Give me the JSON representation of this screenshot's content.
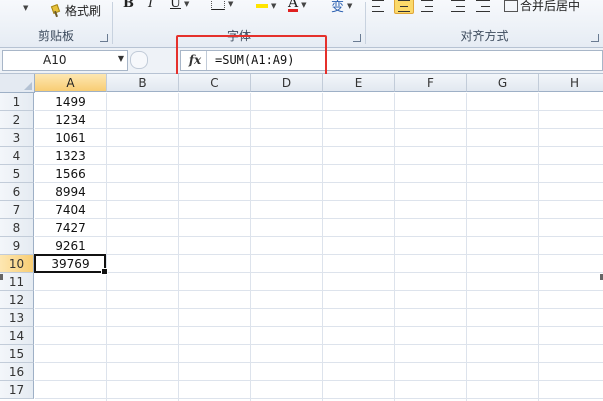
{
  "ribbon": {
    "clipboard": {
      "group_label": "剪贴板",
      "format_painter_label": "格式刷"
    },
    "font": {
      "group_label": "字体",
      "bold": "B",
      "italic": "I",
      "underline": "U",
      "font_color_glyph": "A",
      "phonetic_glyph": "变"
    },
    "alignment": {
      "group_label": "对齐方式",
      "merge_center_label": "合并后居中"
    }
  },
  "formula_bar": {
    "name_box": "A10",
    "fx_label": "fx",
    "formula": "=SUM(A1:A9)"
  },
  "columns": [
    "A",
    "B",
    "C",
    "D",
    "E",
    "F",
    "G",
    "H"
  ],
  "rows": [
    "1",
    "2",
    "3",
    "4",
    "5",
    "6",
    "7",
    "8",
    "9",
    "10",
    "11",
    "12",
    "13",
    "14",
    "15",
    "16",
    "17"
  ],
  "column_a_values": [
    "1499",
    "1234",
    "1061",
    "1323",
    "1566",
    "8994",
    "7404",
    "7427",
    "9261",
    "39769"
  ],
  "active_cell": {
    "column": "A",
    "row": "10"
  },
  "colors": {
    "highlight": "#e5302b",
    "active_header": "#f8cd74",
    "font_color": "#e02020",
    "fill_color": "#ffe400"
  }
}
